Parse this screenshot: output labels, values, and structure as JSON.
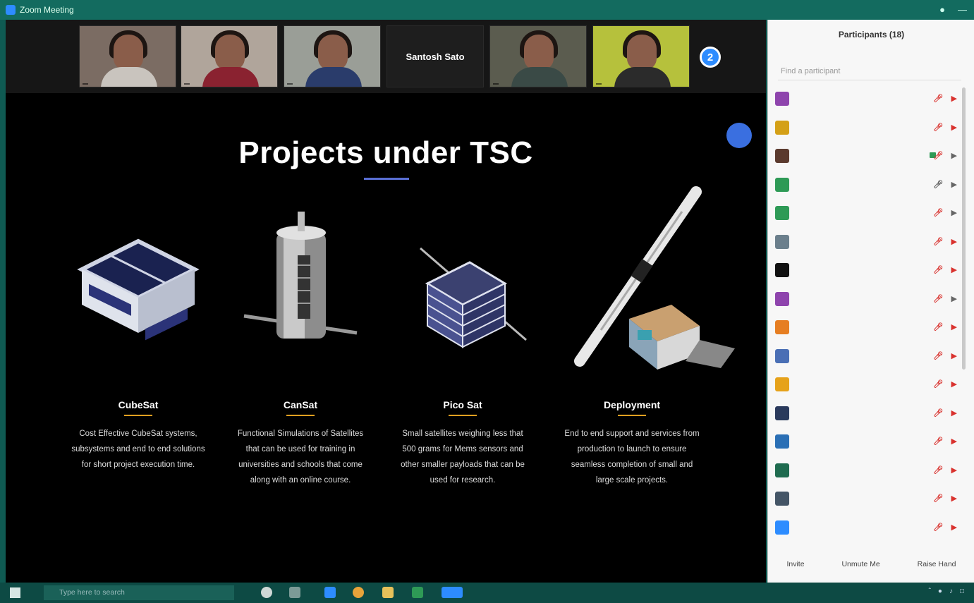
{
  "window": {
    "title": "Zoom Meeting"
  },
  "video_strip": {
    "tiles": [
      {
        "name": "",
        "shirt": "#c9c4be",
        "bg": "#7b6c63"
      },
      {
        "name": "",
        "shirt": "#8a2230",
        "bg": "#b0a59b"
      },
      {
        "name": "",
        "shirt": "#2a3c6b",
        "bg": "#9a9e97"
      },
      {
        "name": "Santosh Sato",
        "name_only": true
      },
      {
        "name": "",
        "shirt": "#3a4a46",
        "bg": "#5b5c4f"
      },
      {
        "name": "",
        "shirt": "#2b2b2b",
        "bg": "#b6c13c"
      }
    ],
    "next_label": "2"
  },
  "slide": {
    "title": "Projects under TSC",
    "projects": [
      {
        "title": "CubeSat",
        "description": "Cost Effective CubeSat systems, subsystems and end to end solutions for short project execution time."
      },
      {
        "title": "CanSat",
        "description": "Functional Simulations of Satellites that can be used for training in universities and schools that come along with an online course."
      },
      {
        "title": "Pico Sat",
        "description": "Small satellites weighing less that 500 grams for Mems sensors and other smaller payloads that can be used for research."
      },
      {
        "title": "Deployment",
        "description": "End to end support and services from production to launch to ensure seamless completion of small and large scale projects."
      }
    ]
  },
  "participants": {
    "header": "Participants (18)",
    "header_left": "",
    "search_placeholder": "Find a participant",
    "rows": [
      {
        "name": "",
        "color": "#8e44ad",
        "initial": "",
        "muted": true,
        "video_off": true,
        "video_badge": false
      },
      {
        "name": "",
        "color": "#d4a017",
        "initial": "",
        "muted": true,
        "video_off": true,
        "video_badge": false
      },
      {
        "name": "",
        "color": "#5b3a2e",
        "initial": "",
        "muted": true,
        "video_off": false,
        "video_badge": true
      },
      {
        "name": "",
        "color": "#2e9a56",
        "initial": "",
        "muted": false,
        "video_off": false,
        "video_badge": false
      },
      {
        "name": "",
        "color": "#2e9a56",
        "initial": "",
        "muted": true,
        "video_off": false,
        "video_badge": false
      },
      {
        "name": "",
        "color": "#6b7f8c",
        "initial": "",
        "muted": true,
        "video_off": true,
        "video_badge": false
      },
      {
        "name": "",
        "color": "#111111",
        "initial": "",
        "muted": true,
        "video_off": true,
        "video_badge": false
      },
      {
        "name": "",
        "color": "#8e44ad",
        "initial": "",
        "muted": true,
        "video_off": false,
        "video_badge": false
      },
      {
        "name": "",
        "color": "#e67e22",
        "initial": "",
        "muted": true,
        "video_off": true,
        "video_badge": false
      },
      {
        "name": "",
        "color": "#4a6fb5",
        "initial": "",
        "muted": true,
        "video_off": true,
        "video_badge": false
      },
      {
        "name": "",
        "color": "#e6a21a",
        "initial": "",
        "muted": true,
        "video_off": true,
        "video_badge": false
      },
      {
        "name": "",
        "color": "#2a3a5c",
        "initial": "",
        "muted": true,
        "video_off": true,
        "video_badge": false
      },
      {
        "name": "",
        "color": "#2a6fb5",
        "initial": "",
        "muted": true,
        "video_off": true,
        "video_badge": false
      },
      {
        "name": "",
        "color": "#1f6b4f",
        "initial": "",
        "muted": true,
        "video_off": true,
        "video_badge": false
      },
      {
        "name": "",
        "color": "#445566",
        "initial": "",
        "muted": true,
        "video_off": true,
        "video_badge": false
      },
      {
        "name": "",
        "color": "#2d8cff",
        "initial": "",
        "muted": true,
        "video_off": true,
        "video_badge": false
      }
    ],
    "footer": {
      "invite": "Invite",
      "unmute": "Unmute Me",
      "raise": "Raise Hand"
    }
  },
  "taskbar": {
    "search_placeholder": "Type here to search"
  },
  "colors": {
    "accent": "#2d8cff",
    "taskbar": "#0d4a44",
    "slide_bg": "#000000",
    "underline": "#5a6fd4"
  }
}
